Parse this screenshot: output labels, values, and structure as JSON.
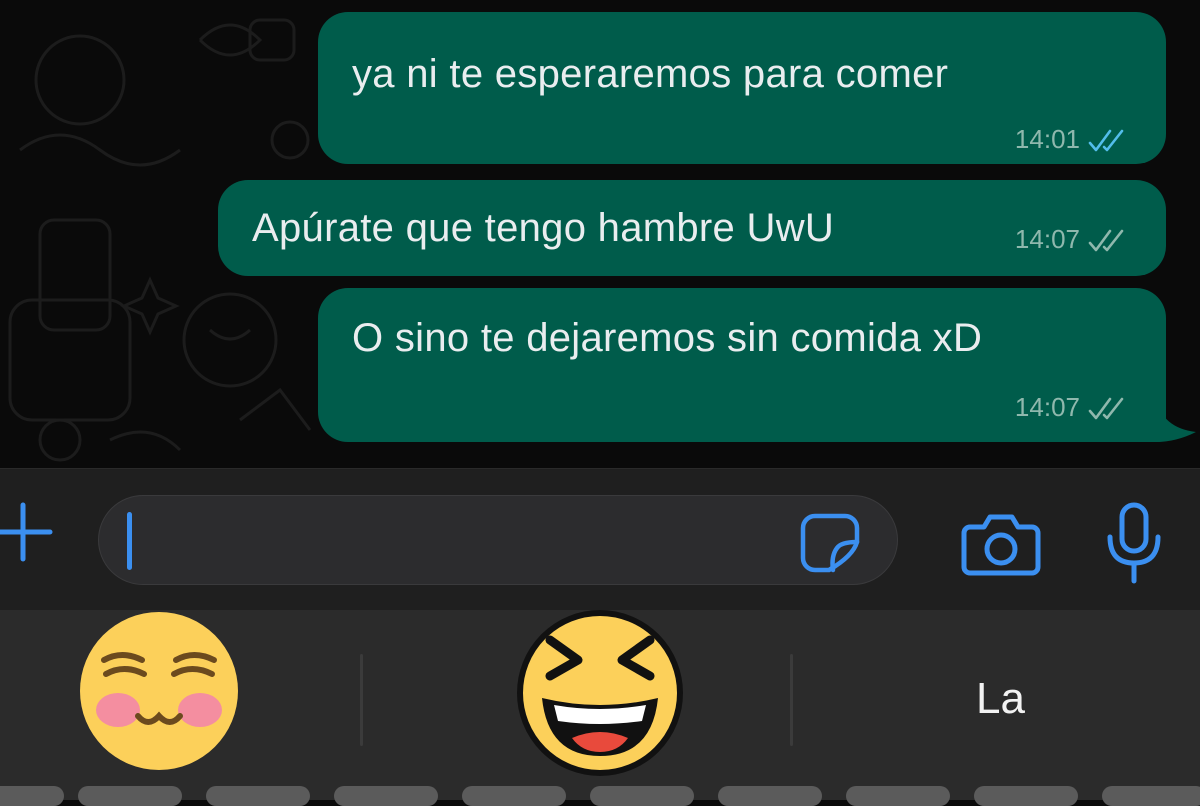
{
  "messages": [
    {
      "text": "ya ni te esperaremos para comer",
      "time": "14:01",
      "status": "read",
      "tick_icon": "double-check-read-icon"
    },
    {
      "text": "Apúrate que tengo hambre UwU",
      "time": "14:07",
      "status": "delivered",
      "tick_icon": "double-check-delivered-icon"
    },
    {
      "text": "O sino te dejaremos sin comida xD",
      "time": "14:07",
      "status": "delivered",
      "tick_icon": "double-check-delivered-icon"
    }
  ],
  "composer": {
    "value": "",
    "plus_icon": "plus-icon",
    "sticker_icon": "sticker-icon",
    "camera_icon": "camera-icon",
    "mic_icon": "microphone-icon"
  },
  "suggestions": {
    "emoji_1": "smiling-face-with-closed-eyes-and-blush-emoji",
    "emoji_2": "grinning-squinting-face-emoji",
    "word": "La"
  },
  "colors": {
    "bubble": "#005c4b",
    "accent": "#3b8ff0",
    "read_tick": "#53bdeb",
    "background": "#0a0a0a"
  }
}
